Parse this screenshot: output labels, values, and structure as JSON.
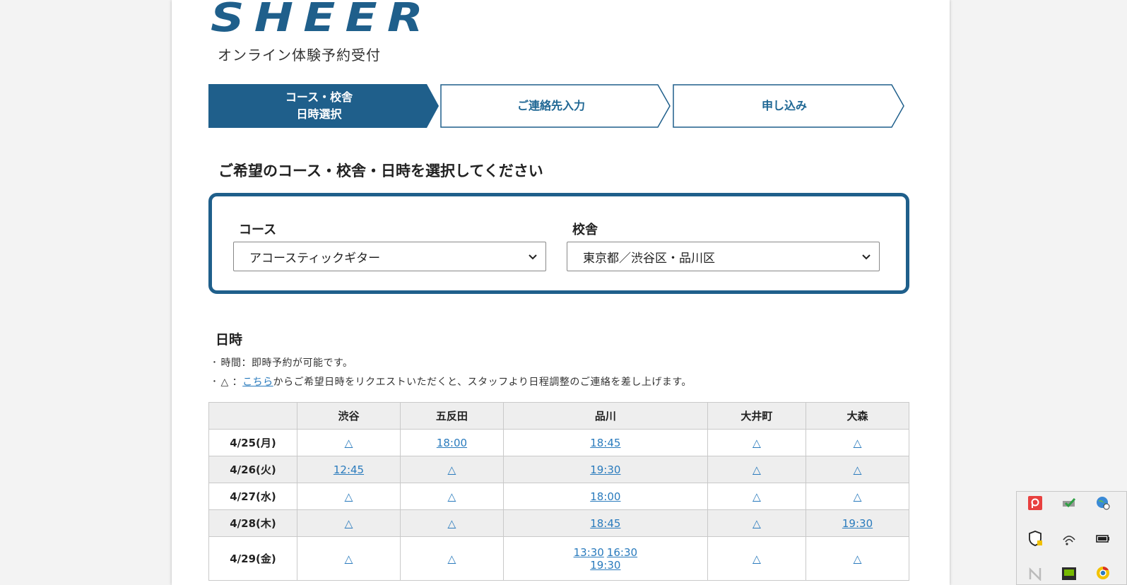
{
  "brand": {
    "logo_text": "SHEER",
    "subtitle": "オンライン体験予約受付",
    "color": "#1f5f8b"
  },
  "steps": [
    {
      "label_line1": "コース・校舎",
      "label_line2": "日時選択",
      "active": true
    },
    {
      "label_line1": "ご連絡先入力",
      "label_line2": "",
      "active": false
    },
    {
      "label_line1": "申し込み",
      "label_line2": "",
      "active": false
    }
  ],
  "section_title": "ご希望のコース・校舎・日時を選択してください",
  "course": {
    "label": "コース",
    "value": "アコースティックギター"
  },
  "school": {
    "label": "校舎",
    "value": "東京都／渋谷区・品川区"
  },
  "datetime": {
    "title": "日時",
    "note1": "･ 時間：即時予約が可能です。",
    "note2_prefix": "･ △ ：",
    "note2_link": "こちら",
    "note2_suffix": "からご希望日時をリクエストいただくと、スタッフより日程調整のご連絡を差し上げます。"
  },
  "table": {
    "columns": [
      "",
      "渋谷",
      "五反田",
      "品川",
      "大井町",
      "大森"
    ],
    "rows": [
      {
        "date": "4/25(月)",
        "cells": [
          [
            "△"
          ],
          [
            "18:00"
          ],
          [
            "18:45"
          ],
          [
            "△"
          ],
          [
            "△"
          ]
        ]
      },
      {
        "date": "4/26(火)",
        "cells": [
          [
            "12:45"
          ],
          [
            "△"
          ],
          [
            "19:30"
          ],
          [
            "△"
          ],
          [
            "△"
          ]
        ]
      },
      {
        "date": "4/27(水)",
        "cells": [
          [
            "△"
          ],
          [
            "△"
          ],
          [
            "18:00"
          ],
          [
            "△"
          ],
          [
            "△"
          ]
        ]
      },
      {
        "date": "4/28(木)",
        "cells": [
          [
            "△"
          ],
          [
            "△"
          ],
          [
            "18:45"
          ],
          [
            "△"
          ],
          [
            "19:30"
          ]
        ]
      },
      {
        "date": "4/29(金)",
        "cells": [
          [
            "△"
          ],
          [
            "△"
          ],
          [
            "13:30",
            "16:30",
            "19:30"
          ],
          [
            "△"
          ],
          [
            "△"
          ]
        ]
      }
    ]
  },
  "colors": {
    "accent": "#1f5f8b",
    "link": "#2a7bbd",
    "row_shade": "#eeeeee"
  },
  "tray_icons": [
    "pocket-icon",
    "network-check-icon",
    "globe-sync-icon",
    "security-warning-icon",
    "wifi-icon",
    "battery-icon",
    "nvidia-n-icon",
    "gpu-icon",
    "chrome-icon"
  ]
}
